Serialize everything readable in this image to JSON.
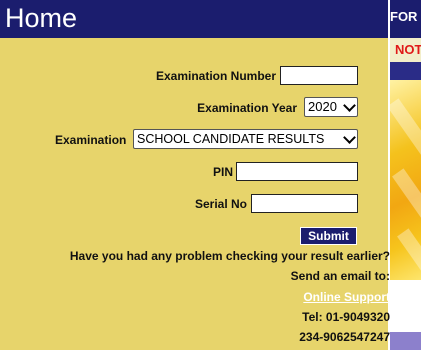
{
  "header": {
    "title": "Home"
  },
  "right_panel": {
    "header_text": "FOR A",
    "notice_text": "NOT"
  },
  "form": {
    "exam_number_label": "Examination Number",
    "exam_number_value": "",
    "exam_year_label": "Examination Year",
    "exam_year_value": "2020",
    "exam_label": "Examination",
    "exam_value": "SCHOOL CANDIDATE RESULTS",
    "pin_label": "PIN",
    "pin_value": "",
    "serial_label": "Serial No",
    "serial_value": "",
    "submit_label": "Submit"
  },
  "support": {
    "question": "Have you had any problem checking your result earlier?",
    "email_prompt": "Send an email to:",
    "link_label": "Online Support",
    "tel": "Tel: 01-9049320",
    "phone2": "234-9062547247"
  },
  "colors": {
    "header_bg": "#1b1d6e",
    "panel_bg": "#e7d46b"
  }
}
